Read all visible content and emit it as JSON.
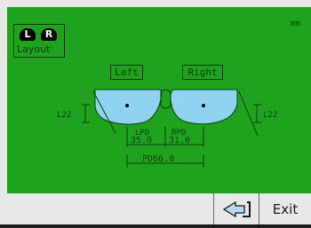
{
  "layout_button": {
    "left_badge": "L",
    "right_badge": "R",
    "label": "Layout"
  },
  "unit": "mm",
  "lenses": {
    "left_label": "Left",
    "right_label": "Right"
  },
  "measurements": {
    "left_height": "L22",
    "right_height": "L22",
    "lpd_label": "LPD",
    "rpd_label": "RPD",
    "lpd_value": "35.0",
    "rpd_value": "31.0",
    "pd_value": "PD66.0"
  },
  "toolbar": {
    "exit_label": "Exit"
  },
  "colors": {
    "background": "#1fa31f",
    "lens_fill": "#8fd3f0",
    "line": "#0d3d0d"
  }
}
